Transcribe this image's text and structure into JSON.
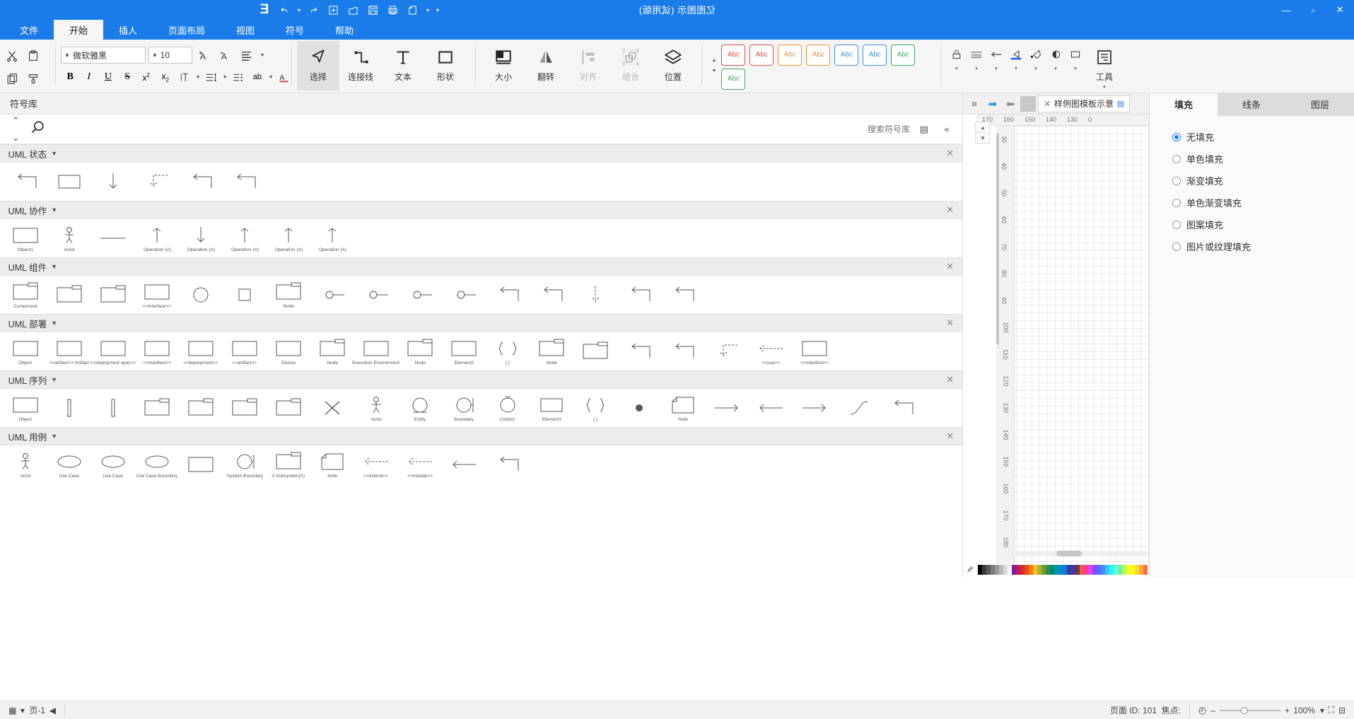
{
  "window": {
    "title": "亿图图示 (试用版)",
    "buttons": {
      "minimize": "—",
      "maximize": "▫",
      "close": "✕"
    }
  },
  "quick_access": {
    "items": [
      {
        "name": "logo",
        "glyph": "E"
      },
      {
        "name": "redo",
        "glyph": "↷"
      },
      {
        "name": "redo-dropdown",
        "glyph": "▾"
      },
      {
        "name": "undo",
        "glyph": "↶"
      },
      {
        "name": "new",
        "glyph": "⊞"
      },
      {
        "name": "open",
        "glyph": "🗀"
      },
      {
        "name": "save",
        "glyph": "🖫"
      },
      {
        "name": "print",
        "glyph": "🖶"
      },
      {
        "name": "export",
        "glyph": "🗋"
      },
      {
        "name": "customize",
        "glyph": "▾"
      },
      {
        "name": "more",
        "glyph": "▾"
      }
    ]
  },
  "ribbon": {
    "tabs": [
      {
        "label": "文件",
        "active": false
      },
      {
        "label": "开始",
        "active": true
      },
      {
        "label": "插人",
        "active": false
      },
      {
        "label": "页面布局",
        "active": false
      },
      {
        "label": "视图",
        "active": false
      },
      {
        "label": "符号",
        "active": false
      },
      {
        "label": "帮助",
        "active": false
      }
    ],
    "groups": {
      "clipboard": [
        {
          "label": "剪切",
          "icon": "scissors-icon"
        },
        {
          "label": "复制",
          "icon": "copy-icon"
        }
      ],
      "shape_tools": [
        {
          "label": "大小",
          "icon": "size-icon",
          "disabled": false
        },
        {
          "label": "翻转",
          "icon": "flip-icon",
          "disabled": false
        },
        {
          "label": "对齐",
          "icon": "align-icon",
          "disabled": true
        },
        {
          "label": "组合",
          "icon": "group-icon",
          "disabled": true
        },
        {
          "label": "位置",
          "icon": "position-icon",
          "disabled": false
        }
      ],
      "draw_tools": [
        {
          "label": "选择",
          "icon": "cursor-icon",
          "active": true
        },
        {
          "label": "连接线",
          "icon": "connector-icon",
          "active": false
        },
        {
          "label": "文本",
          "icon": "text-icon",
          "active": false
        },
        {
          "label": "形状",
          "icon": "shape-icon",
          "active": false
        }
      ],
      "font": {
        "name": "微软雅黑",
        "size": "10",
        "grow_label": "A",
        "shrink_label": "A",
        "bold": "B",
        "italic": "I",
        "underline": "U",
        "strikethrough": "S",
        "superscript": "x²",
        "subscript": "x₂",
        "clear_format": "ab",
        "font_color": "A",
        "bullets": "☰",
        "line_spacing": "↕",
        "align": "≡"
      },
      "styles": [
        {
          "label": "Abc",
          "color": "#d94f4f"
        },
        {
          "label": "Abc",
          "color": "#d94f4f"
        },
        {
          "label": "Abc",
          "color": "#e8922a"
        },
        {
          "label": "Abc",
          "color": "#e8922a"
        },
        {
          "label": "Abc",
          "color": "#3b8fe0"
        },
        {
          "label": "Abc",
          "color": "#3b8fe0"
        },
        {
          "label": "Abc",
          "color": "#3aa85f"
        },
        {
          "label": "Abc",
          "color": "#3aa85f"
        }
      ],
      "left_tools": [
        {
          "label": "工具",
          "icon": "tools-icon"
        },
        {
          "label": "",
          "icon": "paste-icon"
        },
        {
          "label": "",
          "icon": "pen-icon"
        },
        {
          "label": "",
          "icon": "arrow-icon"
        },
        {
          "label": "",
          "icon": "line-color-icon"
        },
        {
          "label": "",
          "icon": "fill-icon"
        },
        {
          "label": "",
          "icon": "shadow-icon"
        },
        {
          "label": "",
          "icon": "ellipse-icon"
        },
        {
          "label": "",
          "icon": "lock-icon"
        }
      ]
    }
  },
  "property_panel": {
    "tabs": [
      {
        "label": "填充",
        "active": true
      },
      {
        "label": "线条",
        "active": false
      },
      {
        "label": "图层",
        "active": false
      }
    ],
    "fill_options": [
      {
        "label": "无填充",
        "selected": true
      },
      {
        "label": "单色填充",
        "selected": false
      },
      {
        "label": "渐变填充",
        "selected": false
      },
      {
        "label": "单色渐变填充",
        "selected": false
      },
      {
        "label": "图案填充",
        "selected": false
      },
      {
        "label": "图片或纹理填充",
        "selected": false
      }
    ]
  },
  "canvas": {
    "doc_tab": "样例图模板示意",
    "doc_tab_close": "✕",
    "nav_back": "⬅",
    "nav_forward": "➡",
    "collapse": "«",
    "ruler_h_ticks": [
      "170",
      "160",
      "150",
      "140",
      "130",
      "0"
    ],
    "ruler_v_ticks": [
      "30",
      "40",
      "50",
      "60",
      "70",
      "80",
      "90",
      "100",
      "110",
      "120",
      "130",
      "140",
      "150",
      "160",
      "170",
      "180"
    ]
  },
  "library": {
    "header_title": "符号库",
    "search_placeholder": "搜索符号库",
    "search_icon": "search-icon",
    "sections": [
      {
        "name": "UML 状态",
        "shapes": [
          {
            "label": "",
            "type": "corner-arrow"
          },
          {
            "label": "",
            "type": "back-arrow"
          },
          {
            "label": "",
            "type": "down-arrow"
          },
          {
            "label": "",
            "type": "dashed-arrow"
          },
          {
            "label": "",
            "type": "elbow-arrow"
          },
          {
            "label": "",
            "type": "elbow2-arrow"
          }
        ]
      },
      {
        "name": "UML 协作",
        "shapes": [
          {
            "label": "Object1",
            "type": "object-box"
          },
          {
            "label": "Actor",
            "type": "actor"
          },
          {
            "label": "",
            "type": "line"
          },
          {
            "label": "Operation (A)",
            "type": "op-left"
          },
          {
            "label": "Operation (A)",
            "type": "op-down"
          },
          {
            "label": "Operation (A)",
            "type": "op-right"
          },
          {
            "label": "Operation (A)",
            "type": "op-up"
          },
          {
            "label": "Operation (A)",
            "type": "op-up2"
          }
        ]
      },
      {
        "name": "UML 组件",
        "shapes": [
          {
            "label": "Component",
            "type": "component"
          },
          {
            "label": "",
            "type": "component2"
          },
          {
            "label": "",
            "type": "component3"
          },
          {
            "label": "<<interface>>",
            "type": "interface-box"
          },
          {
            "label": "",
            "type": "circle"
          },
          {
            "label": "",
            "type": "square"
          },
          {
            "label": "Node",
            "type": "node-box"
          },
          {
            "label": "",
            "type": "lollipop1"
          },
          {
            "label": "",
            "type": "lollipop2"
          },
          {
            "label": "",
            "type": "socket"
          },
          {
            "label": "",
            "type": "ball-socket"
          },
          {
            "label": "",
            "type": "elbow"
          },
          {
            "label": "",
            "type": "elbow-down"
          },
          {
            "label": "",
            "type": "dashed-down"
          },
          {
            "label": "",
            "type": "corner1"
          },
          {
            "label": "",
            "type": "corner2"
          }
        ]
      },
      {
        "name": "UML 部署",
        "shapes": [
          {
            "label": "Object",
            "type": "object"
          },
          {
            "label": "<<artifact>> Artifact",
            "type": "artifact"
          },
          {
            "label": "<<deployment spec>>",
            "type": "depspec"
          },
          {
            "label": "<<manifest>>",
            "type": "manifest"
          },
          {
            "label": "<<deployment>>",
            "type": "deployment"
          },
          {
            "label": "<<artifact>>",
            "type": "artifact2"
          },
          {
            "label": "Device",
            "type": "device"
          },
          {
            "label": "Node",
            "type": "node"
          },
          {
            "label": "Execution Environment",
            "type": "execenv"
          },
          {
            "label": "Node",
            "type": "node2"
          },
          {
            "label": "Element2",
            "type": "element2"
          },
          {
            "label": "{ }",
            "type": "constraint"
          },
          {
            "label": "Node",
            "type": "node3"
          },
          {
            "label": "",
            "type": "pkg"
          },
          {
            "label": "",
            "type": "corner-a"
          },
          {
            "label": "",
            "type": "corner-b"
          },
          {
            "label": "",
            "type": "dashed-a"
          },
          {
            "label": "<<use>>",
            "type": "use-arrow"
          },
          {
            "label": "<<manifest>>",
            "type": "manifest-arrow"
          }
        ]
      },
      {
        "name": "UML 序列",
        "shapes": [
          {
            "label": "Object",
            "type": "object-b"
          },
          {
            "label": "",
            "type": "bar1"
          },
          {
            "label": "",
            "type": "bar2"
          },
          {
            "label": "",
            "type": "frame1"
          },
          {
            "label": "",
            "type": "frame2"
          },
          {
            "label": "",
            "type": "frame3"
          },
          {
            "label": "",
            "type": "frame4"
          },
          {
            "label": "",
            "type": "x-mark"
          },
          {
            "label": "Actor",
            "type": "actor-b"
          },
          {
            "label": "Entity",
            "type": "entity"
          },
          {
            "label": "Boundary",
            "type": "boundary"
          },
          {
            "label": "Control",
            "type": "control"
          },
          {
            "label": "Element1",
            "type": "elem1"
          },
          {
            "label": "{ }",
            "type": "brace"
          },
          {
            "label": "",
            "type": "dot"
          },
          {
            "label": "Note",
            "type": "note"
          },
          {
            "label": "",
            "type": "arrow-l"
          },
          {
            "label": "",
            "type": "arrow-r"
          },
          {
            "label": "",
            "type": "arrow-l2"
          },
          {
            "label": "",
            "type": "curve"
          },
          {
            "label": "",
            "type": "corner-c"
          }
        ]
      },
      {
        "name": "UML 用例",
        "shapes": [
          {
            "label": "Actor",
            "type": "actor-c"
          },
          {
            "label": "Use Case",
            "type": "usecase1"
          },
          {
            "label": "Use Case",
            "type": "usecase2"
          },
          {
            "label": "Use Case Boundary",
            "type": "usecase3"
          },
          {
            "label": "",
            "type": "rect-a"
          },
          {
            "label": "System Boundary",
            "type": "sysboundary"
          },
          {
            "label": "A Subsystem(A)",
            "type": "subsystem"
          },
          {
            "label": "Note",
            "type": "note-b"
          },
          {
            "label": "<<extend>>",
            "type": "extend"
          },
          {
            "label": "<<include>>",
            "type": "include"
          },
          {
            "label": "",
            "type": "assoc"
          },
          {
            "label": "",
            "type": "corner-d"
          }
        ]
      }
    ]
  },
  "status_bar": {
    "page_id_label": "页面 ID: 101",
    "focus_label": "焦点:",
    "zoom_percent": "100%",
    "zoom_out": "–",
    "zoom_in": "+",
    "fit_icon": "⛶",
    "page_icon": "⊟",
    "prev_icon": "◀",
    "page_label": "页-1",
    "page_dropdown": "▾",
    "layout_icon": "▦"
  }
}
